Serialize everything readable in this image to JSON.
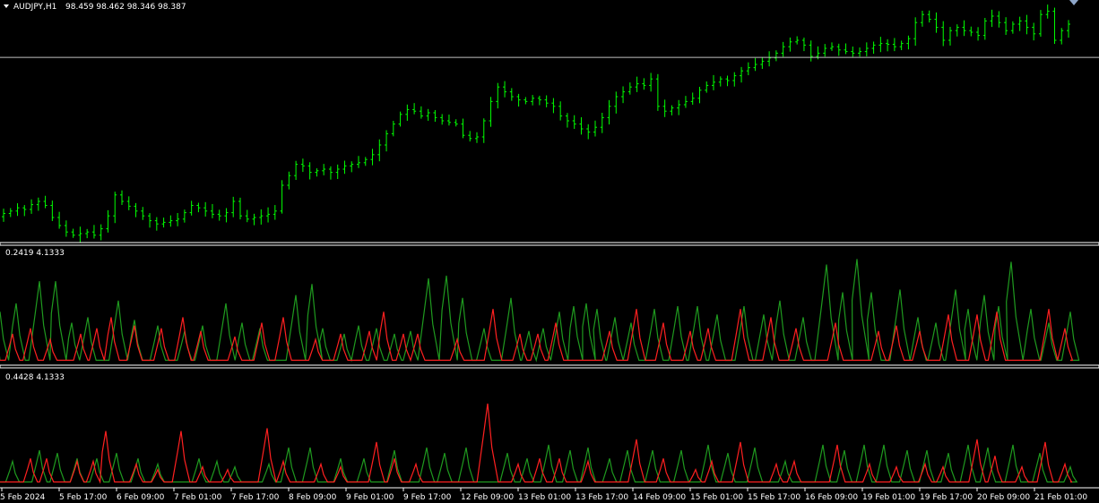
{
  "main_panel": {
    "symbol_label": "AUDJPY,H1",
    "ohlc_label": "98.459 98.462 98.346 98.387",
    "price_line_color": "#c0c0c0"
  },
  "indicator_1": {
    "label": "0.2419 4.1333"
  },
  "indicator_2": {
    "label": "0.4428 4.1333"
  },
  "colors": {
    "bull": "#00ff00",
    "bear": "#ff2020",
    "indicator_green": "#1f9a1f",
    "indicator_red": "#ff2020",
    "separator": "#ffffff"
  },
  "chart_data": [
    {
      "type": "candlestick",
      "symbol": "AUDJPY",
      "timeframe": "H1",
      "close_series": [
        96.45,
        96.48,
        96.52,
        96.5,
        96.56,
        96.6,
        96.55,
        96.4,
        96.3,
        96.22,
        96.18,
        96.2,
        96.22,
        96.18,
        96.26,
        96.42,
        96.68,
        96.6,
        96.54,
        96.48,
        96.42,
        96.36,
        96.32,
        96.34,
        96.36,
        96.38,
        96.46,
        96.55,
        96.52,
        96.48,
        96.44,
        96.42,
        96.46,
        96.6,
        96.42,
        96.38,
        96.4,
        96.42,
        96.44,
        96.48,
        96.8,
        96.92,
        97.06,
        97.04,
        96.96,
        96.98,
        97.0,
        96.96,
        97.0,
        97.04,
        97.06,
        97.08,
        97.12,
        97.18,
        97.3,
        97.44,
        97.56,
        97.68,
        97.74,
        97.72,
        97.66,
        97.7,
        97.64,
        97.6,
        97.58,
        97.56,
        97.42,
        97.38,
        97.4,
        97.6,
        97.84,
        98.02,
        97.96,
        97.9,
        97.86,
        97.84,
        97.88,
        97.86,
        97.82,
        97.78,
        97.66,
        97.6,
        97.56,
        97.5,
        97.46,
        97.52,
        97.64,
        97.78,
        97.9,
        97.96,
        98.02,
        98.06,
        98.04,
        98.12,
        97.78,
        97.72,
        97.76,
        97.8,
        97.84,
        97.88,
        97.98,
        98.04,
        98.08,
        98.12,
        98.1,
        98.16,
        98.22,
        98.26,
        98.3,
        98.34,
        98.38,
        98.44,
        98.52,
        98.58,
        98.6,
        98.54,
        98.4,
        98.44,
        98.5,
        98.52,
        98.48,
        98.46,
        98.44,
        98.46,
        98.5,
        98.54,
        98.56,
        98.55,
        98.52,
        98.56,
        98.62,
        98.82,
        98.92,
        98.86,
        98.76,
        98.6,
        98.72,
        98.76,
        98.72,
        98.7,
        98.66,
        98.84,
        98.9,
        98.82,
        98.72,
        98.8,
        98.84,
        98.76,
        98.68,
        98.92,
        98.96,
        98.6,
        98.72,
        98.8
      ],
      "ylim": [
        96.1,
        99.1
      ],
      "current_price": 98.387,
      "time_labels": [
        "5 Feb 2024",
        "5 Feb 17:00",
        "6 Feb 09:00",
        "7 Feb 01:00",
        "7 Feb 17:00",
        "8 Feb 09:00",
        "9 Feb 01:00",
        "9 Feb 17:00",
        "12 Feb 09:00",
        "13 Feb 01:00",
        "13 Feb 17:00",
        "14 Feb 09:00",
        "15 Feb 01:00",
        "15 Feb 17:00",
        "16 Feb 09:00",
        "19 Feb 01:00",
        "19 Feb 17:00",
        "20 Feb 09:00",
        "21 Feb 01:00"
      ]
    },
    {
      "type": "line",
      "panel": "indicator_1",
      "ylim": [
        0,
        4.1333
      ],
      "series": [
        {
          "color": "green",
          "peaks": [
            [
              0,
              1.8
            ],
            [
              18,
              2.1
            ],
            [
              44,
              2.9
            ],
            [
              62,
              2.9
            ],
            [
              80,
              1.4
            ],
            [
              98,
              1.6
            ],
            [
              132,
              2.2
            ],
            [
              150,
              1.5
            ],
            [
              176,
              1.3
            ],
            [
              206,
              1.1
            ],
            [
              226,
              1.3
            ],
            [
              252,
              2.1
            ],
            [
              270,
              1.4
            ],
            [
              290,
              1.2
            ],
            [
              330,
              2.4
            ],
            [
              348,
              2.8
            ],
            [
              360,
              1.2
            ],
            [
              384,
              1.0
            ],
            [
              400,
              1.3
            ],
            [
              420,
              1.2
            ],
            [
              440,
              1.0
            ],
            [
              458,
              1.1
            ],
            [
              478,
              3.0
            ],
            [
              498,
              3.1
            ],
            [
              516,
              2.3
            ],
            [
              540,
              1.2
            ],
            [
              570,
              2.3
            ],
            [
              590,
              1.1
            ],
            [
              606,
              1.2
            ],
            [
              624,
              1.8
            ],
            [
              640,
              2.0
            ],
            [
              654,
              2.1
            ],
            [
              666,
              1.9
            ],
            [
              686,
              1.6
            ],
            [
              704,
              1.4
            ],
            [
              730,
              1.9
            ],
            [
              756,
              2.0
            ],
            [
              778,
              2.0
            ],
            [
              800,
              1.7
            ],
            [
              830,
              2.0
            ],
            [
              852,
              1.7
            ],
            [
              870,
              2.2
            ],
            [
              896,
              1.6
            ],
            [
              922,
              3.5
            ],
            [
              940,
              2.5
            ],
            [
              956,
              3.7
            ],
            [
              972,
              2.5
            ],
            [
              1004,
              2.6
            ],
            [
              1024,
              1.6
            ],
            [
              1044,
              1.4
            ],
            [
              1066,
              2.6
            ],
            [
              1080,
              1.9
            ],
            [
              1098,
              2.4
            ],
            [
              1114,
              2.0
            ],
            [
              1128,
              3.6
            ],
            [
              1150,
              1.9
            ],
            [
              1170,
              1.4
            ],
            [
              1194,
              1.8
            ]
          ]
        },
        {
          "color": "red",
          "peaks": [
            [
              14,
              1.0
            ],
            [
              34,
              1.2
            ],
            [
              56,
              0.8
            ],
            [
              90,
              1.0
            ],
            [
              108,
              1.2
            ],
            [
              124,
              1.6
            ],
            [
              150,
              1.3
            ],
            [
              180,
              1.2
            ],
            [
              204,
              1.6
            ],
            [
              224,
              1.1
            ],
            [
              262,
              0.9
            ],
            [
              292,
              1.4
            ],
            [
              316,
              1.6
            ],
            [
              352,
              0.8
            ],
            [
              380,
              1.0
            ],
            [
              412,
              1.1
            ],
            [
              428,
              1.8
            ],
            [
              450,
              1.0
            ],
            [
              466,
              1.0
            ],
            [
              510,
              0.8
            ],
            [
              550,
              1.9
            ],
            [
              580,
              1.0
            ],
            [
              600,
              1.0
            ],
            [
              620,
              1.4
            ],
            [
              680,
              1.1
            ],
            [
              710,
              1.9
            ],
            [
              740,
              1.4
            ],
            [
              770,
              1.1
            ],
            [
              790,
              1.2
            ],
            [
              826,
              1.9
            ],
            [
              860,
              1.6
            ],
            [
              888,
              1.2
            ],
            [
              932,
              1.4
            ],
            [
              980,
              1.1
            ],
            [
              1000,
              1.3
            ],
            [
              1026,
              1.1
            ],
            [
              1058,
              1.7
            ],
            [
              1090,
              1.7
            ],
            [
              1112,
              1.8
            ],
            [
              1170,
              1.9
            ],
            [
              1188,
              1.2
            ]
          ]
        }
      ]
    },
    {
      "type": "line",
      "panel": "indicator_2",
      "ylim": [
        0,
        4.1333
      ],
      "series": [
        {
          "color": "green",
          "peaks": [
            [
              14,
              0.8
            ],
            [
              44,
              1.2
            ],
            [
              64,
              1.1
            ],
            [
              86,
              0.9
            ],
            [
              108,
              0.9
            ],
            [
              130,
              1.1
            ],
            [
              154,
              0.9
            ],
            [
              176,
              0.7
            ],
            [
              222,
              0.9
            ],
            [
              242,
              0.8
            ],
            [
              262,
              0.6
            ],
            [
              300,
              0.7
            ],
            [
              322,
              1.3
            ],
            [
              346,
              1.3
            ],
            [
              380,
              0.9
            ],
            [
              406,
              0.9
            ],
            [
              440,
              1.2
            ],
            [
              476,
              1.3
            ],
            [
              496,
              1.1
            ],
            [
              520,
              1.3
            ],
            [
              566,
              1.1
            ],
            [
              588,
              0.9
            ],
            [
              612,
              1.4
            ],
            [
              636,
              1.2
            ],
            [
              656,
              1.3
            ],
            [
              680,
              0.9
            ],
            [
              700,
              1.2
            ],
            [
              728,
              1.2
            ],
            [
              760,
              1.2
            ],
            [
              790,
              1.4
            ],
            [
              812,
              1.1
            ],
            [
              842,
              1.3
            ],
            [
              876,
              0.8
            ],
            [
              918,
              1.4
            ],
            [
              942,
              1.2
            ],
            [
              964,
              1.4
            ],
            [
              986,
              1.4
            ],
            [
              1012,
              1.2
            ],
            [
              1034,
              1.2
            ],
            [
              1058,
              1.1
            ],
            [
              1080,
              1.4
            ],
            [
              1102,
              1.3
            ],
            [
              1130,
              1.4
            ],
            [
              1160,
              1.1
            ],
            [
              1194,
              0.6
            ]
          ]
        },
        {
          "color": "red",
          "peaks": [
            [
              34,
              0.9
            ],
            [
              52,
              0.9
            ],
            [
              86,
              0.8
            ],
            [
              104,
              0.8
            ],
            [
              118,
              1.9
            ],
            [
              152,
              0.7
            ],
            [
              176,
              0.5
            ],
            [
              202,
              1.9
            ],
            [
              226,
              0.6
            ],
            [
              254,
              0.5
            ],
            [
              298,
              2.0
            ],
            [
              316,
              0.8
            ],
            [
              358,
              0.7
            ],
            [
              380,
              0.6
            ],
            [
              420,
              1.5
            ],
            [
              440,
              0.9
            ],
            [
              464,
              0.7
            ],
            [
              544,
              2.9
            ],
            [
              578,
              0.7
            ],
            [
              602,
              0.9
            ],
            [
              624,
              0.9
            ],
            [
              656,
              0.8
            ],
            [
              710,
              1.6
            ],
            [
              740,
              0.9
            ],
            [
              776,
              0.5
            ],
            [
              794,
              0.8
            ],
            [
              826,
              1.5
            ],
            [
              866,
              0.7
            ],
            [
              886,
              0.8
            ],
            [
              934,
              1.4
            ],
            [
              970,
              0.7
            ],
            [
              1000,
              0.6
            ],
            [
              1032,
              0.7
            ],
            [
              1052,
              0.6
            ],
            [
              1090,
              1.6
            ],
            [
              1110,
              1.0
            ],
            [
              1140,
              0.6
            ],
            [
              1166,
              1.5
            ],
            [
              1188,
              0.7
            ]
          ]
        }
      ]
    }
  ]
}
